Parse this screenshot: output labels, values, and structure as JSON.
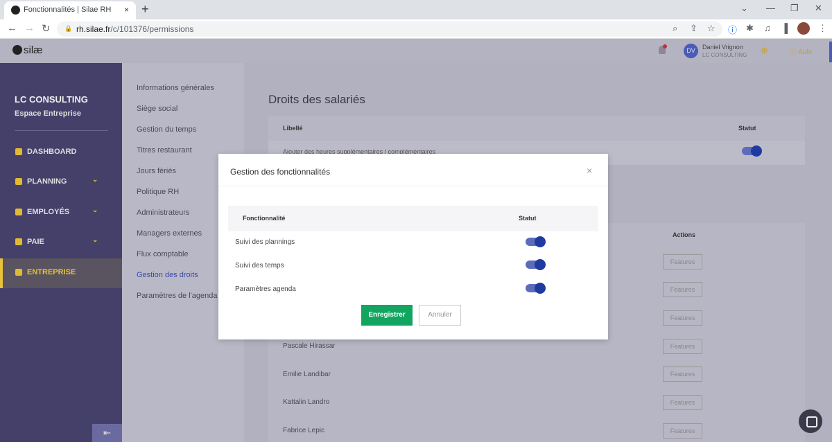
{
  "browser": {
    "tab_title": "Fonctionnalités | Silae RH",
    "url_host": "rh.silae.fr",
    "url_path": "/c/101376/permissions",
    "new_tab": "+",
    "close_tab": "×"
  },
  "header": {
    "logo": "silæ",
    "user_initials": "DV",
    "user_name": "Daniel Vrignon",
    "user_company": "LC CONSULTING",
    "help": "Aide"
  },
  "sidebar": {
    "company": "LC CONSULTING",
    "space": "Espace Entreprise",
    "items": [
      {
        "label": "DASHBOARD"
      },
      {
        "label": "PLANNING"
      },
      {
        "label": "EMPLOYÉS"
      },
      {
        "label": "PAIE"
      },
      {
        "label": "ENTREPRISE"
      }
    ],
    "collapse": "⇤"
  },
  "subnav": [
    "Informations générales",
    "Siège social",
    "Gestion du temps",
    "Titres restaurant",
    "Jours fériés",
    "Politique RH",
    "Administrateurs",
    "Managers externes",
    "Flux comptable",
    "Gestion des droits",
    "Paramètres de l'agenda"
  ],
  "main": {
    "title": "Droits des salariés",
    "col_label": "Libellé",
    "col_status": "Statut",
    "row1": "Ajouter des heures supplémentaires / complémentaires",
    "col_actions": "Actions",
    "features": "Features",
    "employees": [
      "Pascale Hirassar",
      "Emilie Landibar",
      "Kattalin Landro",
      "Fabrice Lepic"
    ]
  },
  "modal": {
    "title": "Gestion des fonctionnalités",
    "close": "×",
    "col_feature": "Fonctionnalité",
    "col_status": "Statut",
    "rows": [
      "Suivi des plannings",
      "Suivi des temps",
      "Paramètres agenda"
    ],
    "save": "Enregistrer",
    "cancel": "Annuler"
  },
  "colors": {
    "accent": "#e9c23a",
    "save": "#12a560",
    "toggle": "#1f3aa0"
  }
}
